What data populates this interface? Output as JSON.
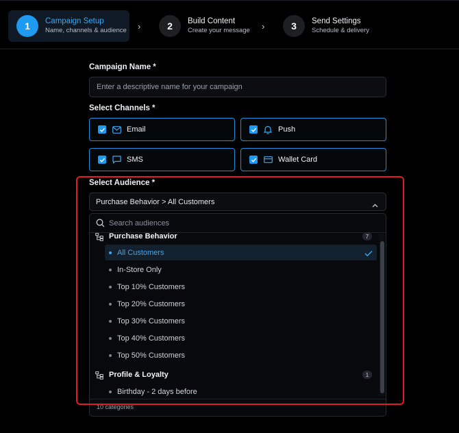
{
  "stepper": {
    "steps": [
      {
        "number": "1",
        "title": "Campaign Setup",
        "subtitle": "Name, channels & audience"
      },
      {
        "number": "2",
        "title": "Build Content",
        "subtitle": "Create your message"
      },
      {
        "number": "3",
        "title": "Send Settings",
        "subtitle": "Schedule & delivery"
      }
    ]
  },
  "form": {
    "campaign_name_label": "Campaign Name *",
    "campaign_name_placeholder": "Enter a descriptive name for your campaign",
    "channels_label": "Select Channels *",
    "channels": [
      {
        "label": "Email",
        "icon": "mail-icon",
        "checked": true
      },
      {
        "label": "Push",
        "icon": "bell-icon",
        "checked": true
      },
      {
        "label": "SMS",
        "icon": "chat-icon",
        "checked": true
      },
      {
        "label": "Wallet Card",
        "icon": "card-icon",
        "checked": true
      }
    ],
    "audience_label": "Select Audience *",
    "audience_value": "Purchase Behavior > All Customers"
  },
  "audience_dropdown": {
    "search_placeholder": "Search audiences",
    "groups": [
      {
        "name": "Purchase Behavior",
        "count": "7",
        "options": [
          "All Customers",
          "In-Store Only",
          "Top 10% Customers",
          "Top 20% Customers",
          "Top 30% Customers",
          "Top 40% Customers",
          "Top 50% Customers"
        ],
        "selected": "All Customers"
      },
      {
        "name": "Profile & Loyalty",
        "count": "1",
        "options": [
          "Birthday - 2 days before"
        ]
      }
    ],
    "footer": "10 categories"
  },
  "colors": {
    "accent": "#1e9bf0",
    "highlight": "#e01c24",
    "background": "#000000"
  }
}
